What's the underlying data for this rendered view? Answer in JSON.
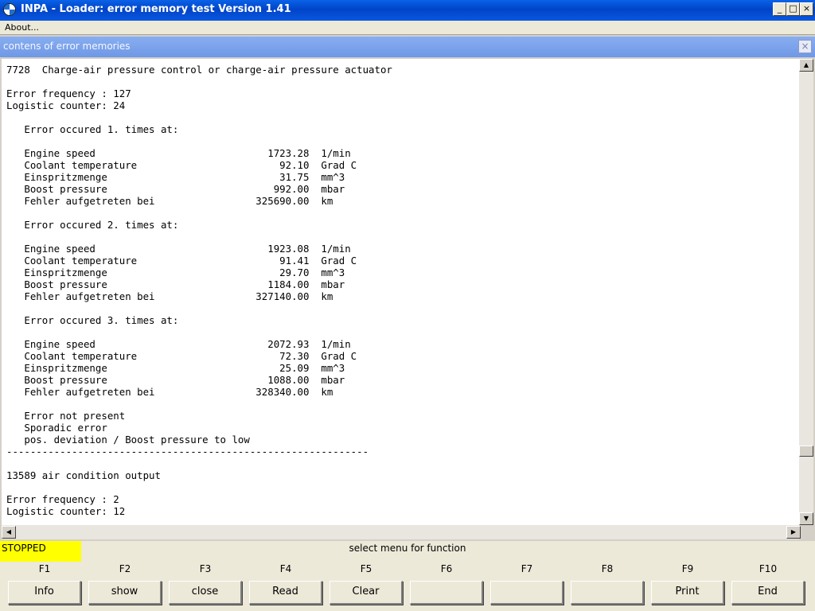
{
  "window": {
    "title": "INPA - Loader:  error memory test  Version 1.41",
    "minimize": "_",
    "maximize": "□",
    "close": "×"
  },
  "menubar": {
    "about": "About..."
  },
  "child_window": {
    "title": "contens of error memories",
    "close": "×"
  },
  "content_lines": [
    "7728  Charge-air pressure control or charge-air pressure actuator",
    "",
    "Error frequency : 127",
    "Logistic counter: 24",
    "",
    "   Error occured 1. times at:",
    "",
    "   Engine speed                             1723.28  1/min",
    "   Coolant temperature                        92.10  Grad C",
    "   Einspritzmenge                             31.75  mm^3",
    "   Boost pressure                            992.00  mbar",
    "   Fehler aufgetreten bei                 325690.00  km",
    "",
    "   Error occured 2. times at:",
    "",
    "   Engine speed                             1923.08  1/min",
    "   Coolant temperature                        91.41  Grad C",
    "   Einspritzmenge                             29.70  mm^3",
    "   Boost pressure                           1184.00  mbar",
    "   Fehler aufgetreten bei                 327140.00  km",
    "",
    "   Error occured 3. times at:",
    "",
    "   Engine speed                             2072.93  1/min",
    "   Coolant temperature                        72.30  Grad C",
    "   Einspritzmenge                             25.09  mm^3",
    "   Boost pressure                           1088.00  mbar",
    "   Fehler aufgetreten bei                 328340.00  km",
    "",
    "   Error not present",
    "   Sporadic error",
    "   pos. deviation / Boost pressure to low",
    "-------------------------------------------------------------",
    "",
    "13589 air condition output",
    "",
    "Error frequency : 2",
    "Logistic counter: 12"
  ],
  "status": {
    "state": "STOPPED",
    "message": "select menu for function"
  },
  "function_keys": [
    {
      "key": "F1",
      "label": "Info"
    },
    {
      "key": "F2",
      "label": "show"
    },
    {
      "key": "F3",
      "label": "close"
    },
    {
      "key": "F4",
      "label": "Read"
    },
    {
      "key": "F5",
      "label": "Clear"
    },
    {
      "key": "F6",
      "label": ""
    },
    {
      "key": "F7",
      "label": ""
    },
    {
      "key": "F8",
      "label": ""
    },
    {
      "key": "F9",
      "label": "Print"
    },
    {
      "key": "F10",
      "label": "End"
    }
  ],
  "scrollbar_position": 0.87,
  "colors": {
    "title_bar": "#0044c8",
    "child_title_bar": "#7aa0ea",
    "status_badge": "#ffff00"
  },
  "icons": {
    "app": "bmw-logo-icon",
    "scroll_up": "▲",
    "scroll_down": "▼",
    "scroll_left": "◀",
    "scroll_right": "▶"
  }
}
